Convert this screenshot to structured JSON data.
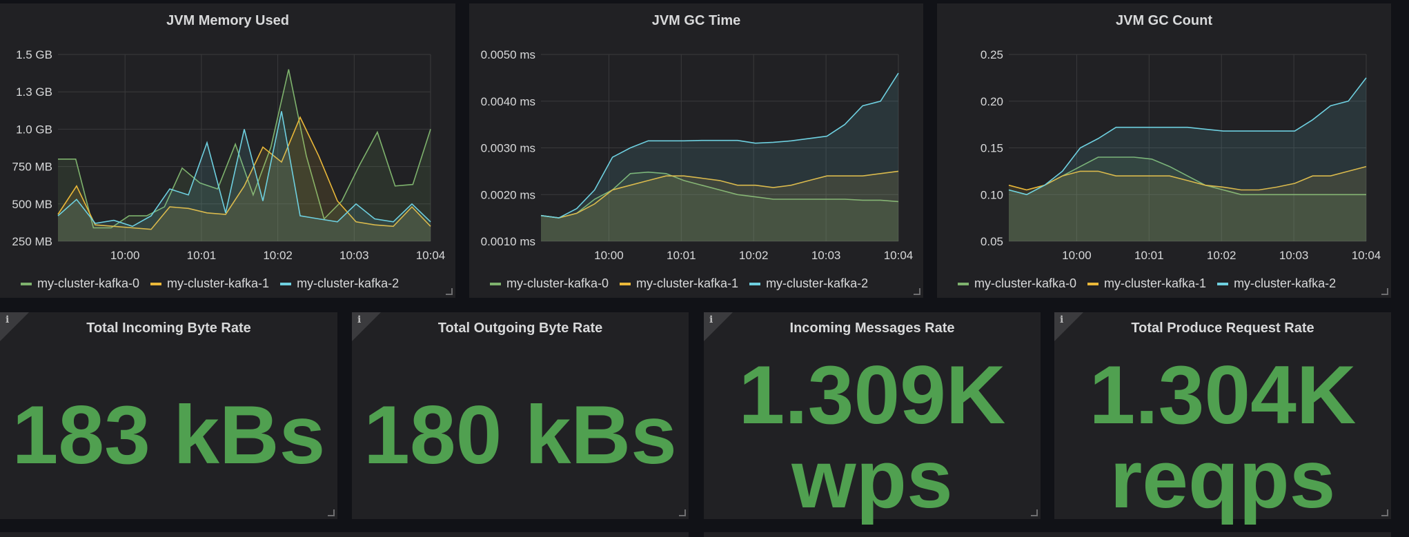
{
  "graphs": [
    {
      "title": "JVM Memory Used",
      "legend": [
        "my-cluster-kafka-0",
        "my-cluster-kafka-1",
        "my-cluster-kafka-2"
      ]
    },
    {
      "title": "JVM GC Time",
      "legend": [
        "my-cluster-kafka-0",
        "my-cluster-kafka-1",
        "my-cluster-kafka-2"
      ]
    },
    {
      "title": "JVM GC Count",
      "legend": [
        "my-cluster-kafka-0",
        "my-cluster-kafka-1",
        "my-cluster-kafka-2"
      ]
    }
  ],
  "stats": [
    {
      "title": "Total Incoming Byte Rate",
      "value": "183 kBs",
      "info_icon": "i"
    },
    {
      "title": "Total Outgoing Byte Rate",
      "value": "180 kBs",
      "info_icon": "i"
    },
    {
      "title": "Incoming Messages Rate",
      "value_line1": "1.309K",
      "value_line2": "wps",
      "info_icon": "i"
    },
    {
      "title": "Total Produce Request Rate",
      "value_line1": "1.304K",
      "value_line2": "reqps",
      "info_icon": "i"
    }
  ],
  "colors": {
    "series": [
      "#7eb26d",
      "#eab839",
      "#6ed0e0"
    ],
    "stat_value": "#50a050",
    "panel_bg": "#212124",
    "page_bg": "#111217"
  },
  "chart_data": [
    {
      "type": "line",
      "title": "JVM Memory Used",
      "x": [
        "09:59:10",
        "09:59:20",
        "09:59:30",
        "09:59:40",
        "09:59:50",
        "10:00:00",
        "10:00:10",
        "10:00:20",
        "10:00:30",
        "10:00:40",
        "10:00:50",
        "10:01:00",
        "10:01:10",
        "10:01:20",
        "10:01:30",
        "10:01:40",
        "10:01:50",
        "10:02:00",
        "10:02:10",
        "10:02:20",
        "10:02:30",
        "10:02:40",
        "10:02:50",
        "10:03:00",
        "10:03:10",
        "10:03:20",
        "10:03:30",
        "10:03:40",
        "10:03:50",
        "10:04:00"
      ],
      "x_tick_labels": [
        "10:00",
        "10:01",
        "10:02",
        "10:03",
        "10:04"
      ],
      "y_tick_labels": [
        "250 MB",
        "500 MB",
        "750 MB",
        "1.0 GB",
        "1.3 GB",
        "1.5 GB"
      ],
      "ylim_mb": [
        250,
        1500
      ],
      "fill": true,
      "series": [
        {
          "name": "my-cluster-kafka-0",
          "values_mb": [
            800,
            800,
            340,
            340,
            420,
            420,
            480,
            740,
            640,
            600,
            900,
            560,
            880,
            1400,
            820,
            400,
            520,
            760,
            980,
            620,
            630,
            1000
          ]
        },
        {
          "name": "my-cluster-kafka-1",
          "values_mb": [
            430,
            620,
            360,
            350,
            340,
            330,
            480,
            470,
            440,
            430,
            620,
            880,
            780,
            1080,
            820,
            520,
            380,
            360,
            350,
            480,
            350
          ]
        },
        {
          "name": "my-cluster-kafka-2",
          "values_mb": [
            420,
            530,
            370,
            390,
            350,
            420,
            600,
            560,
            910,
            440,
            1000,
            520,
            1120,
            420,
            400,
            380,
            500,
            400,
            380,
            500,
            380
          ]
        }
      ]
    },
    {
      "type": "line",
      "title": "JVM GC Time",
      "x_tick_labels": [
        "10:00",
        "10:01",
        "10:02",
        "10:03",
        "10:04"
      ],
      "y_tick_labels": [
        "0.0010 ms",
        "0.0020 ms",
        "0.0030 ms",
        "0.0040 ms",
        "0.0050 ms"
      ],
      "ylim_ms": [
        0.001,
        0.005
      ],
      "fill": true,
      "series": [
        {
          "name": "my-cluster-kafka-0",
          "values_ms": [
            0.00155,
            0.0015,
            0.0016,
            0.0019,
            0.0021,
            0.00245,
            0.00248,
            0.00245,
            0.0023,
            0.0022,
            0.0021,
            0.002,
            0.00195,
            0.0019,
            0.0019,
            0.0019,
            0.0019,
            0.0019,
            0.00188,
            0.00188,
            0.00185
          ]
        },
        {
          "name": "my-cluster-kafka-1",
          "values_ms": [
            0.00155,
            0.0015,
            0.0016,
            0.0018,
            0.0021,
            0.0022,
            0.0023,
            0.0024,
            0.0024,
            0.00235,
            0.0023,
            0.0022,
            0.0022,
            0.00215,
            0.0022,
            0.0023,
            0.0024,
            0.0024,
            0.0024,
            0.00245,
            0.0025
          ]
        },
        {
          "name": "my-cluster-kafka-2",
          "values_ms": [
            0.00155,
            0.0015,
            0.0017,
            0.0021,
            0.0028,
            0.003,
            0.00315,
            0.00315,
            0.00315,
            0.00316,
            0.00316,
            0.00316,
            0.0031,
            0.00312,
            0.00315,
            0.0032,
            0.00325,
            0.0035,
            0.0039,
            0.004,
            0.0046
          ]
        }
      ]
    },
    {
      "type": "line",
      "title": "JVM GC Count",
      "x_tick_labels": [
        "10:00",
        "10:01",
        "10:02",
        "10:03",
        "10:04"
      ],
      "y_tick_labels": [
        "0.05",
        "0.10",
        "0.15",
        "0.20",
        "0.25"
      ],
      "ylim": [
        0.05,
        0.25
      ],
      "fill": true,
      "series": [
        {
          "name": "my-cluster-kafka-0",
          "values": [
            0.105,
            0.1,
            0.11,
            0.12,
            0.13,
            0.14,
            0.14,
            0.14,
            0.138,
            0.13,
            0.12,
            0.11,
            0.105,
            0.1,
            0.1,
            0.1,
            0.1,
            0.1,
            0.1,
            0.1,
            0.1
          ]
        },
        {
          "name": "my-cluster-kafka-1",
          "values": [
            0.11,
            0.105,
            0.11,
            0.12,
            0.125,
            0.125,
            0.12,
            0.12,
            0.12,
            0.12,
            0.115,
            0.11,
            0.108,
            0.105,
            0.105,
            0.108,
            0.112,
            0.12,
            0.12,
            0.125,
            0.13
          ]
        },
        {
          "name": "my-cluster-kafka-2",
          "values": [
            0.105,
            0.1,
            0.11,
            0.125,
            0.15,
            0.16,
            0.172,
            0.172,
            0.172,
            0.172,
            0.172,
            0.17,
            0.168,
            0.168,
            0.168,
            0.168,
            0.168,
            0.18,
            0.195,
            0.2,
            0.225
          ]
        }
      ]
    }
  ]
}
